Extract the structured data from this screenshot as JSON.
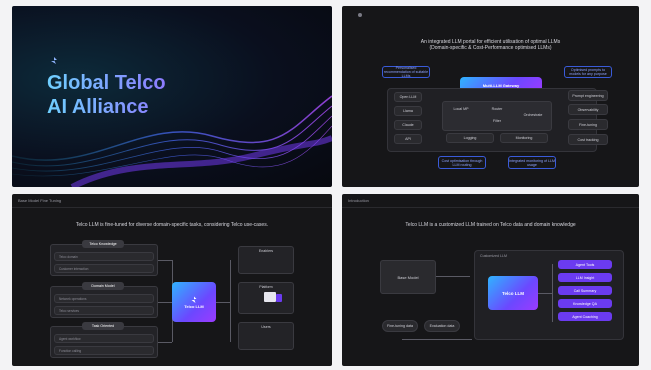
{
  "slide1": {
    "title_line1": "Global Telco",
    "title_line2": "AI Alliance"
  },
  "slide2": {
    "subtitle_line1": "An integrated LLM portal for efficient utilisation of optimal LLMs",
    "subtitle_line2": "(Domain-specific & Cost-Performance optimised LLMs)",
    "gateway": "Multi-LLM Gateway",
    "left_note": "Personalised recommendation of suitable LLMs",
    "right_note": "Optimised prompts to models for any purpose",
    "left_items": [
      "Open LLM",
      "Llama",
      "Claude",
      "API"
    ],
    "center_items": [
      "Local MP",
      "Router",
      "Filter",
      "Orchestrate",
      "Logging",
      "Monitoring"
    ],
    "right_items": [
      "Prompt engineering",
      "Observability",
      "Fine-tuning",
      "Cost tracking"
    ],
    "bottom_left": "Cost optimisation through LLM routing",
    "bottom_right": "Integrated monitoring of LLM usage"
  },
  "slide3": {
    "header": "Base Model Fine Tuning",
    "title": "Telco LLM is fine-tuned for diverse domain-specific tasks, considering Telco use-cases.",
    "blocks": [
      {
        "label": "Telco Knowledge",
        "rows": [
          "Telco domain",
          "Customer interaction"
        ]
      },
      {
        "label": "Domain Model",
        "rows": [
          "Network operations",
          "Telco services"
        ]
      },
      {
        "label": "Task Oriented",
        "rows": [
          "Agent workflow",
          "Function calling"
        ]
      }
    ],
    "center": "Telco LLM",
    "right_blocks": [
      "Enablers",
      "Platform",
      "Users"
    ]
  },
  "slide4": {
    "header": "Introduction",
    "title": "Telco LLM is a customized LLM trained on Telco data and domain knowledge",
    "base_model": "Base Model",
    "bottom_left": "Fine-tuning data",
    "bottom_right": "Evaluation data",
    "container_label": "Customized LLM",
    "center": "Telco LLM",
    "right_items": [
      "Agent Tools",
      "LLM Insight",
      "Call Summary",
      "Knowledge QA",
      "Agent Coaching"
    ]
  }
}
